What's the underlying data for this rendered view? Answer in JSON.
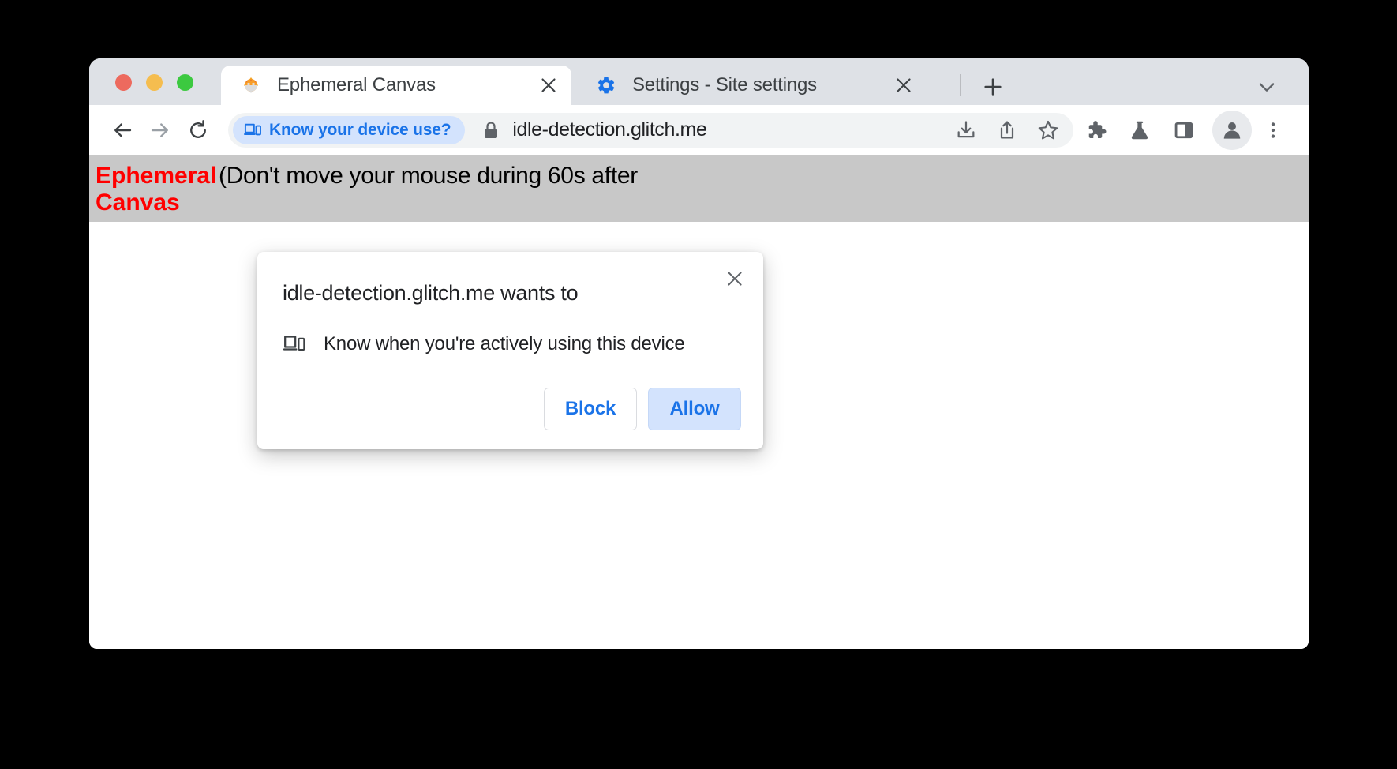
{
  "window": {
    "traffic_lights": [
      {
        "name": "close",
        "color": "#ed6a5e"
      },
      {
        "name": "minimize",
        "color": "#f5bd4f"
      },
      {
        "name": "maximize",
        "color": "#3cc940"
      }
    ]
  },
  "tabs": [
    {
      "title": "Ephemeral Canvas",
      "favicon": "pufferfish-icon",
      "active": true,
      "close_label": "×"
    },
    {
      "title": "Settings - Site settings",
      "favicon": "gear-icon",
      "active": false,
      "close_label": "×"
    }
  ],
  "tabstrip": {
    "new_tab_label": "+",
    "list_all_tabs_label": "⌄"
  },
  "toolbar": {
    "back_label": "←",
    "forward_label": "→",
    "reload_label": "↻",
    "icons": [
      "download-icon",
      "share-icon",
      "bookmark-star-icon",
      "extensions-puzzle-icon",
      "experiments-flask-icon",
      "side-panel-icon",
      "profile-avatar-icon",
      "three-dot-menu-icon"
    ]
  },
  "omnibox": {
    "permission_chip": {
      "label": "Know your device use?",
      "icon": "device-idle-icon",
      "background": "#d3e3fd",
      "text_color": "#1a73e8"
    },
    "security_icon": "lock-icon",
    "url": "idle-detection.glitch.me"
  },
  "page": {
    "heading": "Ephemeral Canvas",
    "heading_color": "#ff0000",
    "banner_background": "#c8c8c8",
    "instruction": "(Don't move your mouse during 60s after"
  },
  "dialog": {
    "title": "idle-detection.glitch.me wants to",
    "permission_icon": "device-idle-icon",
    "permission_text": "Know when you're actively using this device",
    "close_label": "×",
    "block_label": "Block",
    "allow_label": "Allow",
    "accent_color": "#1a73e8"
  }
}
